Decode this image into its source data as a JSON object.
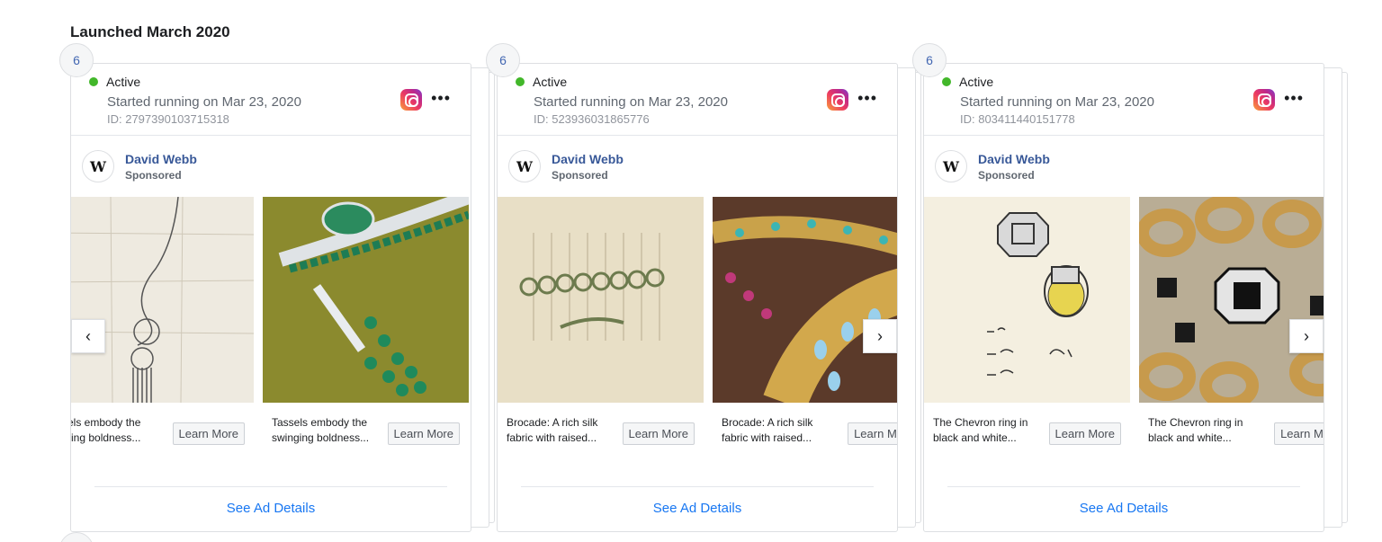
{
  "section": {
    "title": "Launched March 2020"
  },
  "colors": {
    "active_dot": "#42b72a",
    "link_blue": "#1877f2",
    "advertiser_blue": "#385898"
  },
  "cards": [
    {
      "count": "6",
      "status": "Active",
      "started": "Started running on Mar 23, 2020",
      "id": "ID: 2797390103715318",
      "platform_icon": "instagram-icon",
      "advertiser": "David Webb",
      "sponsored": "Sponsored",
      "slides": [
        {
          "text": "ssels embody the inging boldness...",
          "button": "Learn More"
        },
        {
          "text": "Tassels embody the swinging boldness...",
          "button": "Learn More"
        }
      ],
      "nav": "‹",
      "details": "See Ad Details"
    },
    {
      "count": "6",
      "status": "Active",
      "started": "Started running on Mar 23, 2020",
      "id": "ID: 523936031865776",
      "platform_icon": "instagram-icon",
      "advertiser": "David Webb",
      "sponsored": "Sponsored",
      "slides": [
        {
          "text": "Brocade: A rich silk fabric with raised...",
          "button": "Learn More"
        },
        {
          "text": "Brocade: A rich silk fabric with raised...",
          "button": "Learn Mo"
        }
      ],
      "nav": "›",
      "details": "See Ad Details"
    },
    {
      "count": "6",
      "status": "Active",
      "started": "Started running on Mar 23, 2020",
      "id": "ID: 803411440151778",
      "platform_icon": "instagram-icon",
      "advertiser": "David Webb",
      "sponsored": "Sponsored",
      "slides": [
        {
          "text": "The Chevron ring in black and white...",
          "button": "Learn More"
        },
        {
          "text": "The Chevron ring in black and white...",
          "button": "Learn Mo"
        }
      ],
      "nav": "›",
      "details": "See Ad Details"
    }
  ],
  "avatar_mark": "W"
}
